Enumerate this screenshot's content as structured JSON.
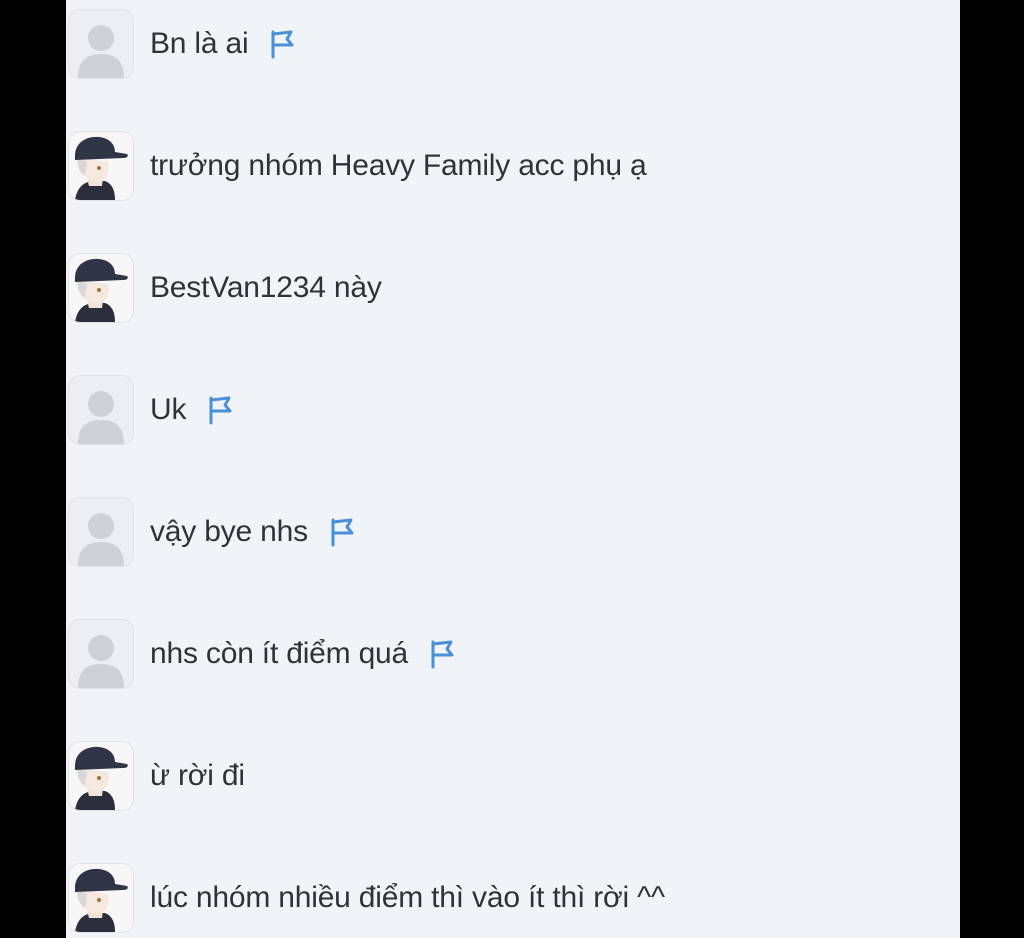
{
  "chat": {
    "messages": [
      {
        "text": "Bn là ai",
        "avatar": "default-avatar",
        "flag": true,
        "flag_icon": "flag-icon"
      },
      {
        "text": "trưởng nhóm Heavy Family acc phụ ạ",
        "avatar": "cap-boy-avatar",
        "flag": false
      },
      {
        "text": "BestVan1234 này",
        "avatar": "cap-boy-avatar",
        "flag": false
      },
      {
        "text": "Uk",
        "avatar": "default-avatar",
        "flag": true,
        "flag_icon": "flag-icon"
      },
      {
        "text": "vậy bye nhs",
        "avatar": "default-avatar",
        "flag": true,
        "flag_icon": "flag-icon"
      },
      {
        "text": "nhs còn ít điểm quá",
        "avatar": "default-avatar",
        "flag": true,
        "flag_icon": "flag-icon"
      },
      {
        "text": "ừ rời đi",
        "avatar": "cap-boy-avatar",
        "flag": false
      },
      {
        "text": "lúc nhóm nhiều điểm thì vào ít thì rời ^^",
        "avatar": "cap-boy-avatar",
        "flag": false
      }
    ]
  },
  "colors": {
    "panel_background": "#f0f3f8",
    "side_background": "#000000",
    "text": "#2f3338",
    "flag": "#4a90d9"
  }
}
